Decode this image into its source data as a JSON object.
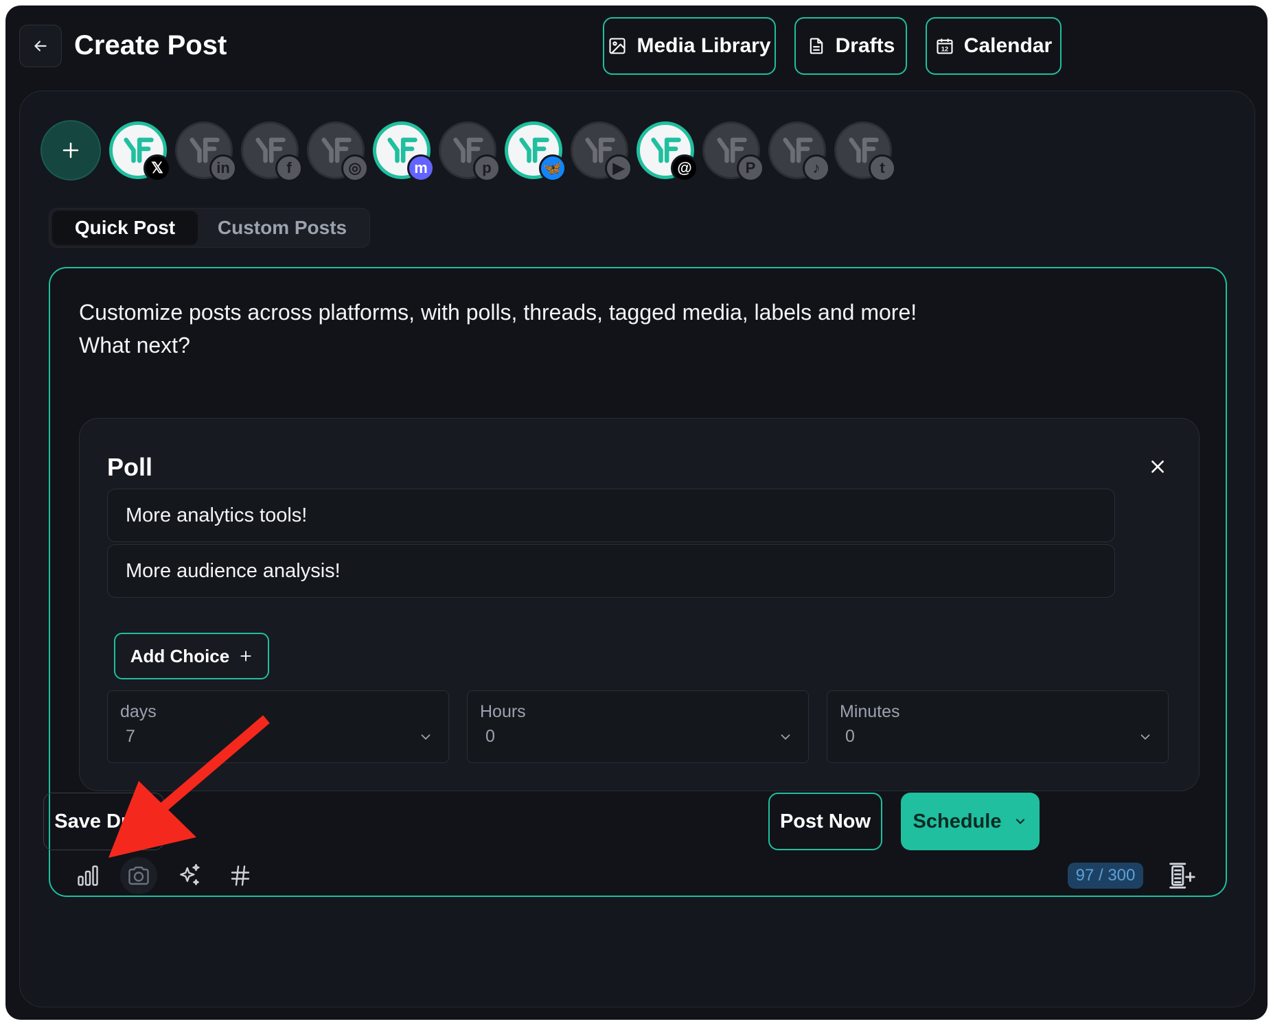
{
  "header": {
    "title": "Create Post",
    "buttons": {
      "media_library": "Media Library",
      "drafts": "Drafts",
      "calendar": "Calendar"
    }
  },
  "accounts": [
    {
      "platform": "x",
      "badge_icon": "x-logo-icon",
      "selected": true,
      "badge_color": "#000000"
    },
    {
      "platform": "linkedin",
      "badge_icon": "linkedin-icon",
      "selected": false,
      "badge_color": "#3a3d43"
    },
    {
      "platform": "facebook",
      "badge_icon": "facebook-icon",
      "selected": false,
      "badge_color": "#3a3d43"
    },
    {
      "platform": "instagram",
      "badge_icon": "instagram-icon",
      "selected": false,
      "badge_color": "#3a3d43"
    },
    {
      "platform": "mastodon",
      "badge_icon": "mastodon-icon",
      "selected": true,
      "badge_color": "#6364ff"
    },
    {
      "platform": "pinterest",
      "badge_icon": "pinterest-icon",
      "selected": false,
      "badge_color": "#3a3d43"
    },
    {
      "platform": "bluesky",
      "badge_icon": "bluesky-icon",
      "selected": true,
      "badge_color": "#1185fe"
    },
    {
      "platform": "youtube",
      "badge_icon": "youtube-icon",
      "selected": false,
      "badge_color": "#3a3d43"
    },
    {
      "platform": "threads",
      "badge_icon": "threads-icon",
      "selected": true,
      "badge_color": "#000000"
    },
    {
      "platform": "patreon",
      "badge_icon": "patreon-icon",
      "selected": false,
      "badge_color": "#3a3d43"
    },
    {
      "platform": "tiktok",
      "badge_icon": "tiktok-icon",
      "selected": false,
      "badge_color": "#3a3d43"
    },
    {
      "platform": "tumblr",
      "badge_icon": "tumblr-icon",
      "selected": false,
      "badge_color": "#3a3d43"
    }
  ],
  "tabs": {
    "quick_post": "Quick Post",
    "custom_posts": "Custom Posts",
    "active": "quick_post"
  },
  "editor": {
    "text_line1": "Customize posts across platforms, with polls, threads, tagged media, labels and more!",
    "text_line2": "What next?",
    "char_count": "97 / 300"
  },
  "poll": {
    "title": "Poll",
    "choices": [
      "More analytics tools!",
      "More audience analysis!"
    ],
    "add_choice_label": "Add Choice",
    "duration": {
      "days_label": "days",
      "days_value": "7",
      "hours_label": "Hours",
      "hours_value": "0",
      "minutes_label": "Minutes",
      "minutes_value": "0"
    }
  },
  "toolbar_icons": [
    "poll-icon",
    "camera-icon",
    "sparkles-icon",
    "hashtag-icon"
  ],
  "footer": {
    "save_draft": "Save Draft",
    "post_now": "Post Now",
    "schedule": "Schedule"
  },
  "colors": {
    "accent": "#1fbf9f",
    "background": "#111318",
    "annotation_arrow": "#f5281e"
  }
}
